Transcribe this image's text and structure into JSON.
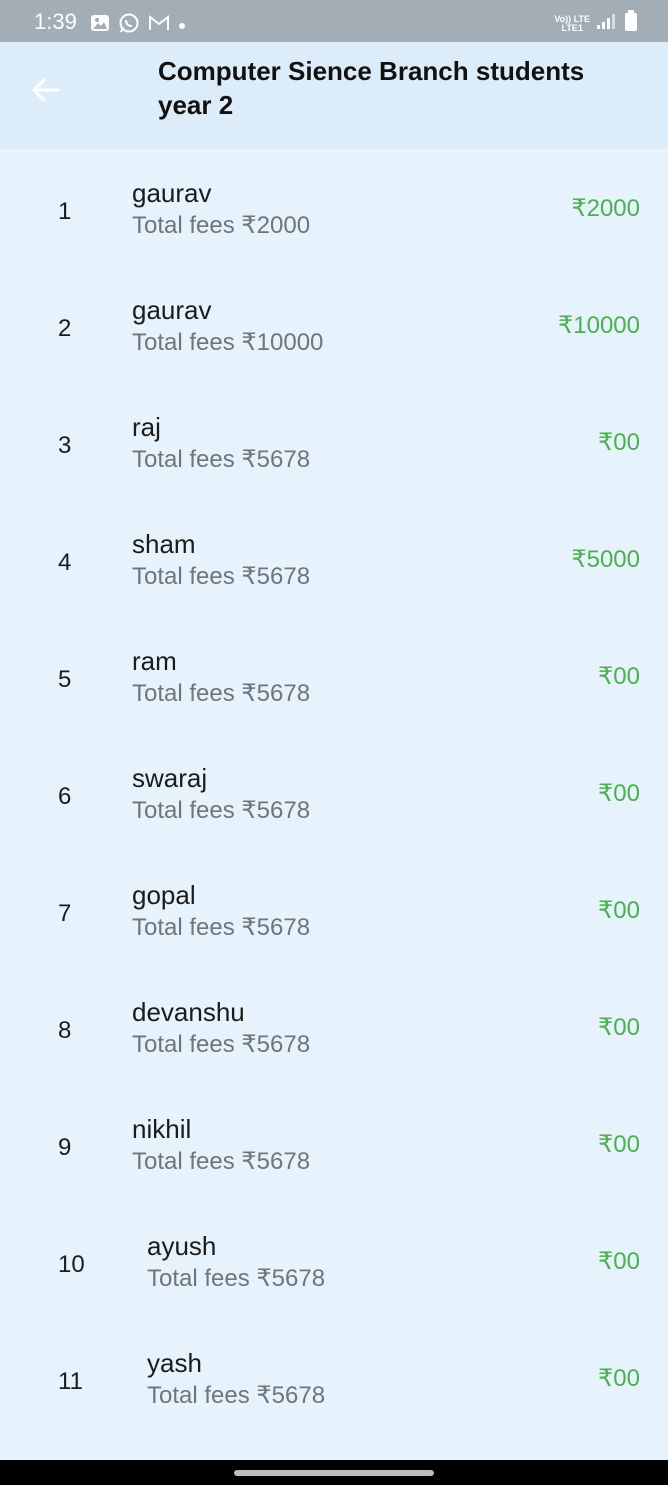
{
  "status_bar": {
    "time": "1:39",
    "notification_icons": [
      "gallery-icon",
      "whatsapp-icon",
      "gmail-icon",
      "dot-icon"
    ],
    "network_label_top": "Vo)) LTE",
    "network_label_bottom": "LTE1"
  },
  "app_bar": {
    "back_icon": "arrow-left-icon",
    "title": "Computer Sience Branch students year 2"
  },
  "students": [
    {
      "index": "1",
      "name": "gaurav",
      "total_fees": "Total fees ₹2000",
      "amount": "₹2000"
    },
    {
      "index": "2",
      "name": "gaurav",
      "total_fees": "Total fees ₹10000",
      "amount": "₹10000"
    },
    {
      "index": "3",
      "name": "raj",
      "total_fees": "Total fees ₹5678",
      "amount": "₹00"
    },
    {
      "index": "4",
      "name": "sham",
      "total_fees": "Total fees ₹5678",
      "amount": "₹5000"
    },
    {
      "index": "5",
      "name": "ram",
      "total_fees": "Total fees ₹5678",
      "amount": "₹00"
    },
    {
      "index": "6",
      "name": "swaraj",
      "total_fees": "Total fees ₹5678",
      "amount": "₹00"
    },
    {
      "index": "7",
      "name": "gopal",
      "total_fees": "Total fees ₹5678",
      "amount": "₹00"
    },
    {
      "index": "8",
      "name": "devanshu",
      "total_fees": "Total fees ₹5678",
      "amount": "₹00"
    },
    {
      "index": "9",
      "name": "nikhil",
      "total_fees": "Total fees ₹5678",
      "amount": "₹00"
    },
    {
      "index": "10",
      "name": "ayush",
      "total_fees": "Total fees ₹5678",
      "amount": "₹00"
    },
    {
      "index": "11",
      "name": "yash",
      "total_fees": "Total fees ₹5678",
      "amount": "₹00"
    }
  ],
  "colors": {
    "background": "#e6f3fc",
    "app_bar": "#dcecf8",
    "status_bar": "#a3adb5",
    "amount": "#4caf50",
    "subtitle": "#707579"
  }
}
